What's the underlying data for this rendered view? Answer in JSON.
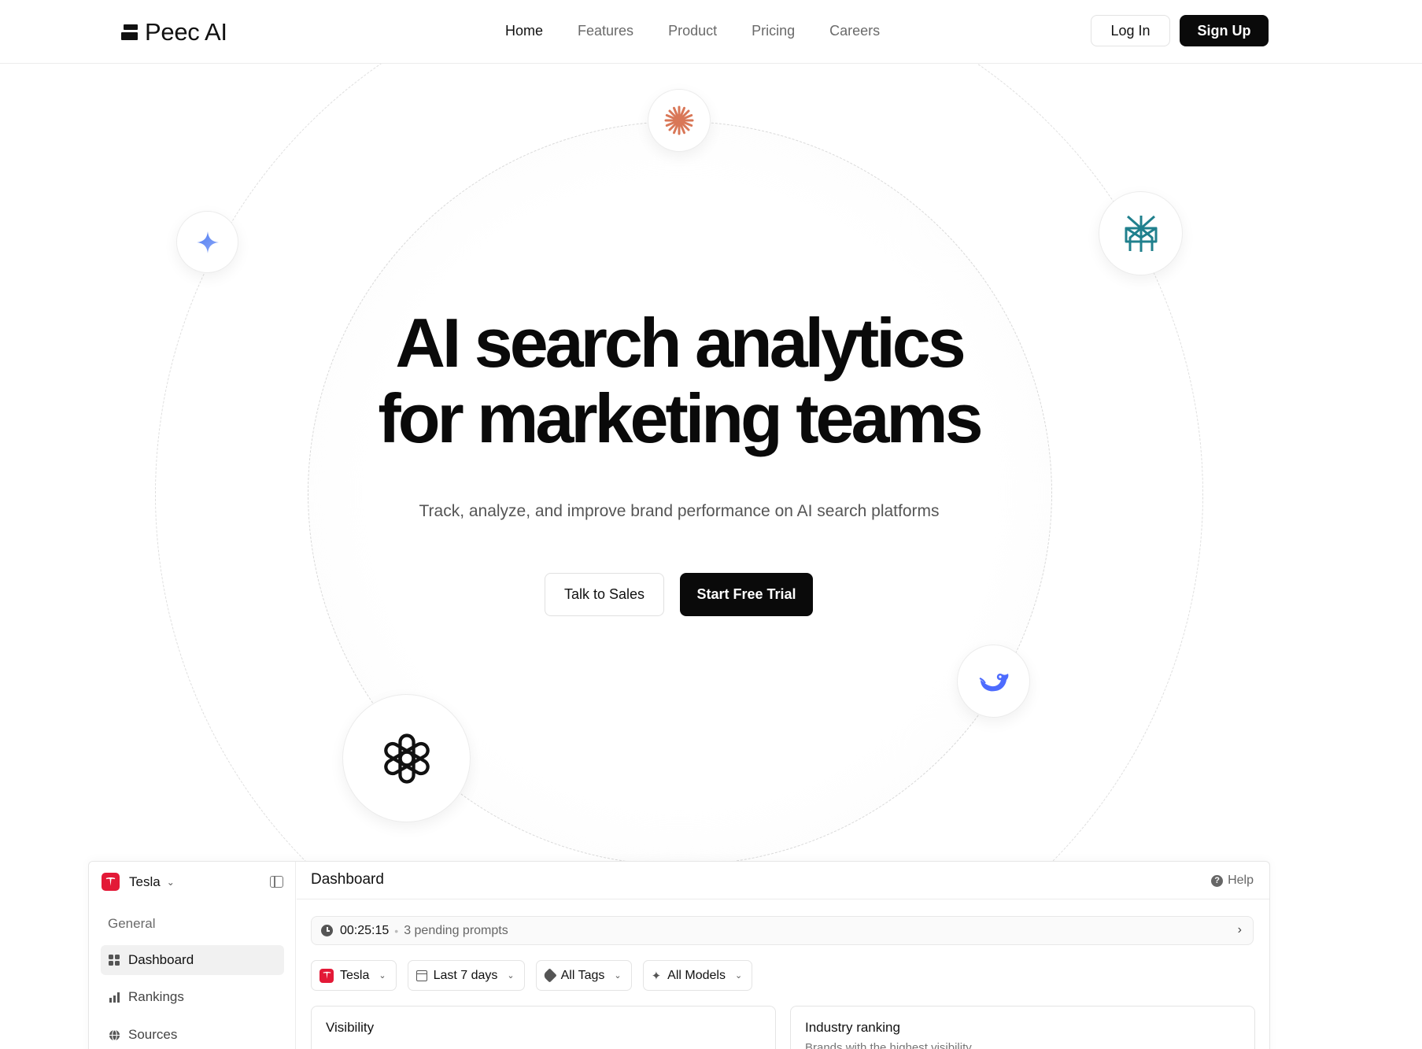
{
  "header": {
    "logo_text": "Peec AI",
    "nav": [
      "Home",
      "Features",
      "Product",
      "Pricing",
      "Careers"
    ],
    "login_label": "Log In",
    "signup_label": "Sign Up"
  },
  "hero": {
    "title_line1": "AI search analytics",
    "title_line2": "for marketing teams",
    "subtitle": "Track, analyze, and improve brand performance on AI search platforms",
    "talk_sales_label": "Talk to Sales",
    "start_trial_label": "Start Free Trial",
    "platform_icons": [
      "claude-icon",
      "gemini-icon",
      "perplexity-icon",
      "deepseek-icon",
      "openai-icon"
    ]
  },
  "dashboard": {
    "sidebar": {
      "brand": "Tesla",
      "section_label": "General",
      "items": [
        {
          "label": "Dashboard",
          "icon": "grid-icon"
        },
        {
          "label": "Rankings",
          "icon": "bar-chart-icon"
        },
        {
          "label": "Sources",
          "icon": "globe-icon"
        }
      ]
    },
    "title": "Dashboard",
    "help_label": "Help",
    "pending": {
      "time": "00:25:15",
      "separator": "•",
      "text": "3 pending prompts"
    },
    "filters": {
      "brand": "Tesla",
      "range": "Last 7 days",
      "tags": "All Tags",
      "models": "All Models"
    },
    "cards": {
      "visibility_title": "Visibility",
      "ranking_title": "Industry ranking",
      "ranking_subtitle": "Brands with the highest visibility"
    }
  },
  "colors": {
    "accent_black": "#0a0a0a",
    "claude_orange": "#d97757",
    "gemini_blue": "#5b8def",
    "perplexity_teal": "#20808d",
    "deepseek_blue": "#4d6bfe",
    "tesla_red": "#e31937"
  }
}
